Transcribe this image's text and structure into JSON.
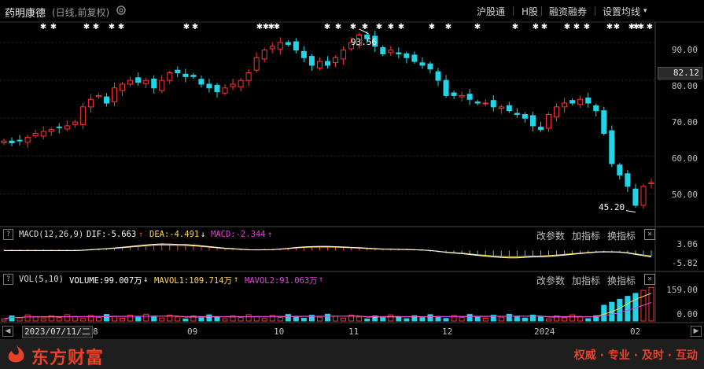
{
  "header": {
    "stock_name": "药明康德",
    "period_label": "(日线,前复权)",
    "buttons": [
      "沪股通",
      "H股",
      "融资融券",
      "设置均线"
    ]
  },
  "main_panel": {
    "y_ticks": [
      "90.00",
      "80.00",
      "70.00",
      "60.00",
      "50.00"
    ],
    "current_price": "82.12",
    "high_label": "93.56",
    "low_label": "45.20",
    "marker": "✱"
  },
  "macd_panel": {
    "title": "MACD(12,26,9)",
    "dif": "DIF:-5.663",
    "dea": "DEA:-4.491",
    "macd": "MACD:-2.344",
    "y_ticks": [
      "3.06",
      "-5.82"
    ],
    "buttons": [
      "改参数",
      "加指标",
      "换指标"
    ]
  },
  "vol_panel": {
    "title": "VOL(5,10)",
    "volume": "VOLUME:99.007万",
    "mavol1": "MAVOL1:109.714万",
    "mavol2": "MAVOL2:91.063万",
    "y_ticks": [
      "159.00",
      "0.00"
    ],
    "buttons": [
      "改参数",
      "加指标",
      "换指标"
    ]
  },
  "x_axis": {
    "date_box": "2023/07/11/二",
    "labels": [
      "8",
      "09",
      "10",
      "11",
      "12",
      "2024",
      "02"
    ]
  },
  "footer": {
    "brand": "东方财富",
    "slogan": "权威 · 专业 · 及时 · 互动"
  },
  "colors": {
    "up": "#ff3333",
    "down": "#22d4e6",
    "dif": "#ffffff",
    "dea": "#ffd84a",
    "mavol2": "#e040e0",
    "brand": "#e8412a"
  },
  "chart_data": {
    "type": "candlestick",
    "date_range": [
      "2023-07-11",
      "2024-02-08"
    ],
    "price_series_close": [
      64,
      63.5,
      64,
      65,
      66,
      66.5,
      67,
      67.5,
      68,
      69,
      73,
      75,
      76,
      74,
      78,
      79,
      80,
      79.5,
      80,
      78,
      80,
      82,
      82,
      81,
      81,
      79,
      78,
      77,
      78,
      79,
      80,
      82,
      86,
      88,
      89,
      90,
      89.5,
      88,
      86,
      84,
      85,
      84,
      86,
      88,
      90,
      92,
      91,
      89,
      87,
      88,
      87,
      86,
      85,
      84,
      83,
      80,
      76,
      76,
      76,
      75,
      74,
      74,
      73,
      73,
      72,
      71,
      70,
      68,
      67,
      71,
      73,
      74,
      74,
      75,
      74,
      72,
      66,
      58,
      55,
      52,
      47,
      52,
      53
    ],
    "price_high": 93.56,
    "price_low": 45.2,
    "price_ylim": [
      42,
      95
    ],
    "macd_ylim": [
      -5.82,
      3.06
    ],
    "vol_ylim": [
      0,
      159
    ]
  }
}
